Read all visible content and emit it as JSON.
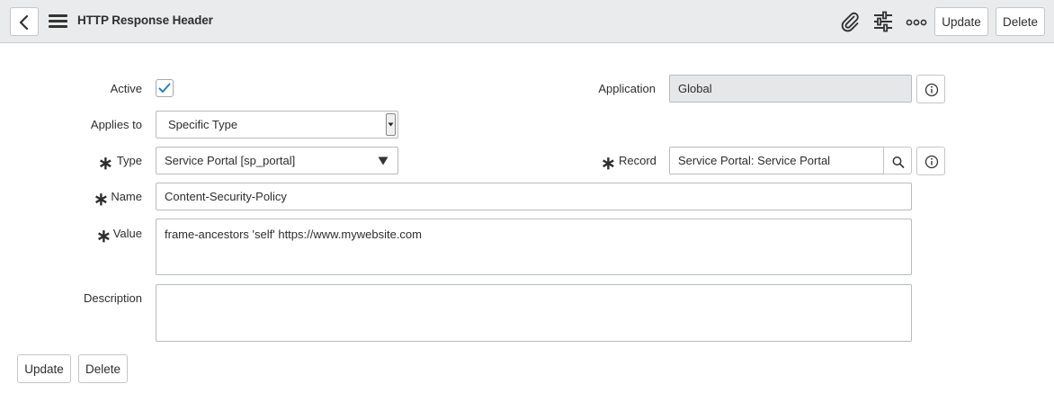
{
  "header": {
    "title": "HTTP Response Header",
    "update_label": "Update",
    "delete_label": "Delete",
    "icons": [
      "chevron-left-icon",
      "hamburger-menu-icon",
      "paperclip-icon",
      "sliders-icon",
      "more-options-icon"
    ]
  },
  "form": {
    "active": {
      "label": "Active",
      "checked": true
    },
    "application": {
      "label": "Application",
      "value": "Global"
    },
    "applies_to": {
      "label": "Applies to",
      "value": "Specific Type"
    },
    "type": {
      "label": "Type",
      "value": "Service Portal [sp_portal]",
      "required": "∗"
    },
    "record": {
      "label": "Record",
      "value": "Service Portal: Service Portal",
      "required": "∗"
    },
    "name": {
      "label": "Name",
      "value": "Content-Security-Policy",
      "required": "∗"
    },
    "value": {
      "label": "Value",
      "value": "frame-ancestors 'self' https://www.mywebsite.com",
      "required": "∗"
    },
    "description": {
      "label": "Description",
      "value": ""
    }
  },
  "footer": {
    "update_label": "Update",
    "delete_label": "Delete"
  },
  "colors": {
    "header_bg": "#eaebec",
    "checkmark": "#2b7ec1",
    "readonly_bg": "#e6e7e8"
  }
}
